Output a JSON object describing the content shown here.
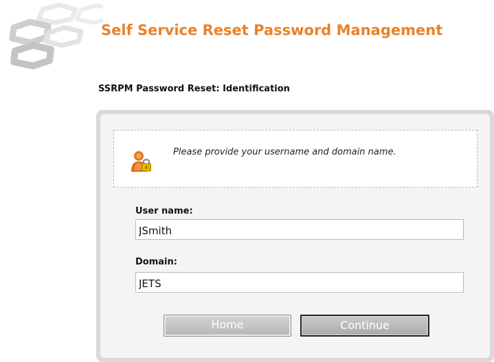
{
  "header": {
    "app_title": "Self Service Reset Password Management"
  },
  "page": {
    "heading": "SSRPM Password Reset: Identification"
  },
  "info": {
    "message": "Please provide your username and domain name.",
    "icon": "user-lock-icon"
  },
  "form": {
    "username_label": "User name:",
    "username_value": "JSmith",
    "domain_label": "Domain:",
    "domain_value": "JETS"
  },
  "buttons": {
    "home_label": "Home",
    "continue_label": "Continue"
  },
  "colors": {
    "title": "#e8822a",
    "panel": "#dadada",
    "icon_person": "#e07a20",
    "icon_lock": "#e5b400"
  }
}
